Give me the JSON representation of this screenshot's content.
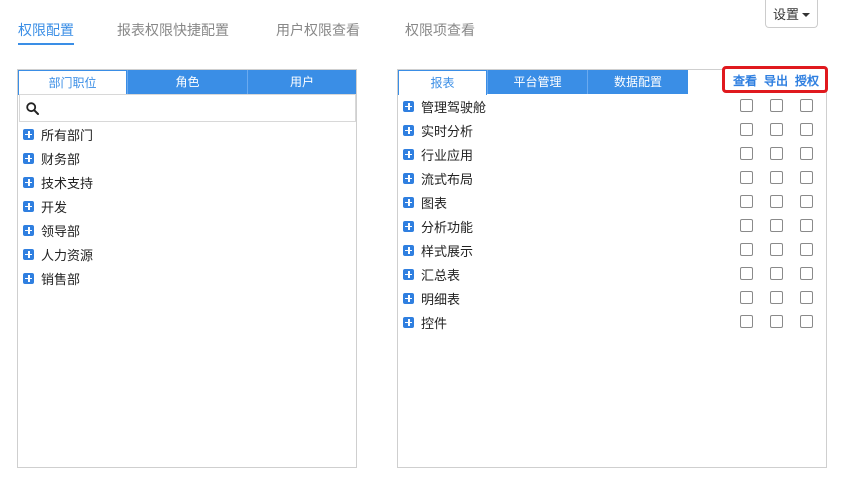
{
  "top_tabs": [
    {
      "label": "权限配置",
      "active": true
    },
    {
      "label": "报表权限快捷配置",
      "active": false
    },
    {
      "label": "用户权限查看",
      "active": false
    },
    {
      "label": "权限项查看",
      "active": false
    }
  ],
  "settings": {
    "label": "设置"
  },
  "left_panel": {
    "tabs": [
      {
        "label": "部门职位",
        "active": true
      },
      {
        "label": "角色",
        "active": false
      },
      {
        "label": "用户",
        "active": false
      }
    ],
    "search": {
      "placeholder": "",
      "value": ""
    },
    "tree": [
      "所有部门",
      "财务部",
      "技术支持",
      "开发",
      "领导部",
      "人力资源",
      "销售部"
    ]
  },
  "right_panel": {
    "tabs": [
      {
        "label": "报表",
        "active": true
      },
      {
        "label": "平台管理",
        "active": false
      },
      {
        "label": "数据配置",
        "active": false
      }
    ],
    "permission_headers": {
      "view": "查看",
      "export": "导出",
      "authorize": "授权"
    },
    "items": [
      {
        "label": "管理驾驶舱",
        "view": false,
        "export": false,
        "authorize": false
      },
      {
        "label": "实时分析",
        "view": false,
        "export": false,
        "authorize": false
      },
      {
        "label": "行业应用",
        "view": false,
        "export": false,
        "authorize": false
      },
      {
        "label": "流式布局",
        "view": false,
        "export": false,
        "authorize": false
      },
      {
        "label": "图表",
        "view": false,
        "export": false,
        "authorize": false
      },
      {
        "label": "分析功能",
        "view": false,
        "export": false,
        "authorize": false
      },
      {
        "label": "样式展示",
        "view": false,
        "export": false,
        "authorize": false
      },
      {
        "label": "汇总表",
        "view": false,
        "export": false,
        "authorize": false
      },
      {
        "label": "明细表",
        "view": false,
        "export": false,
        "authorize": false
      },
      {
        "label": "控件",
        "view": false,
        "export": false,
        "authorize": false
      }
    ]
  },
  "colors": {
    "accent": "#3a8ee6",
    "highlight": "#e0191e",
    "icon": "#2f7fe0"
  }
}
